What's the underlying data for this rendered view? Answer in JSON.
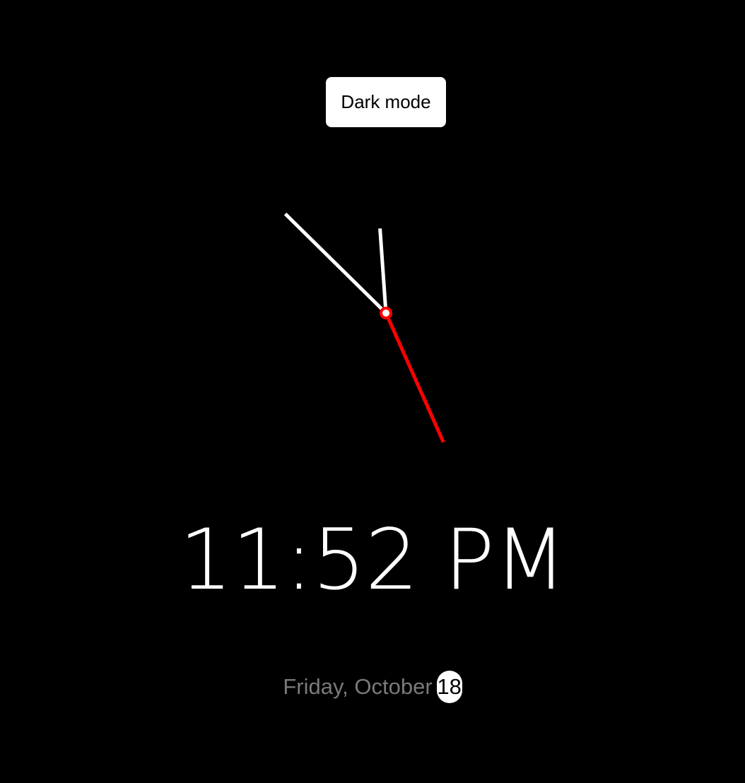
{
  "toolbar": {
    "mode_toggle_label": "Dark mode"
  },
  "clock": {
    "hours": 11,
    "minutes": 52,
    "seconds": 26,
    "hand_color": "#ffffff",
    "second_hand_color": "#ff0000",
    "center_color": "#ff0000"
  },
  "digital": {
    "time_text": "11:52 PM"
  },
  "date": {
    "weekday_month": "Friday, October",
    "day": "18"
  },
  "colors": {
    "background": "#000000",
    "text": "#ffffff",
    "muted_text": "#7a7a7a",
    "accent": "#ff0000"
  }
}
